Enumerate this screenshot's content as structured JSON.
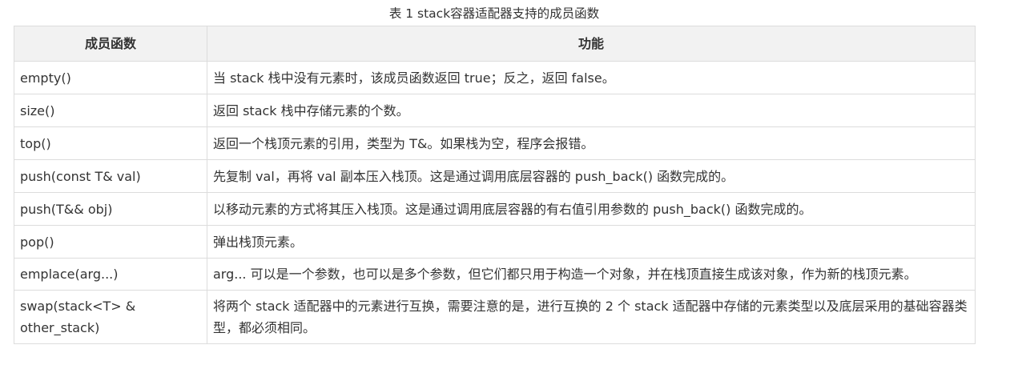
{
  "caption": "表 1 stack容器适配器支持的成员函数",
  "table": {
    "headers": [
      "成员函数",
      "功能"
    ],
    "rows": [
      {
        "func": "empty()",
        "desc": "当 stack 栈中没有元素时，该成员函数返回 true；反之，返回 false。"
      },
      {
        "func": "size()",
        "desc": "返回 stack 栈中存储元素的个数。"
      },
      {
        "func": "top()",
        "desc": "返回一个栈顶元素的引用，类型为 T&。如果栈为空，程序会报错。"
      },
      {
        "func": "push(const T& val)",
        "desc": "先复制 val，再将 val 副本压入栈顶。这是通过调用底层容器的 push_back() 函数完成的。"
      },
      {
        "func": "push(T&& obj)",
        "desc": "以移动元素的方式将其压入栈顶。这是通过调用底层容器的有右值引用参数的 push_back() 函数完成的。"
      },
      {
        "func": "pop()",
        "desc": "弹出栈顶元素。"
      },
      {
        "func": "emplace(arg...)",
        "desc": "arg... 可以是一个参数，也可以是多个参数，但它们都只用于构造一个对象，并在栈顶直接生成该对象，作为新的栈顶元素。"
      },
      {
        "func": "swap(stack<T> & other_stack)",
        "desc": "将两个 stack 适配器中的元素进行互换，需要注意的是，进行互换的 2 个 stack 适配器中存储的元素类型以及底层采用的基础容器类型，都必须相同。"
      }
    ]
  }
}
